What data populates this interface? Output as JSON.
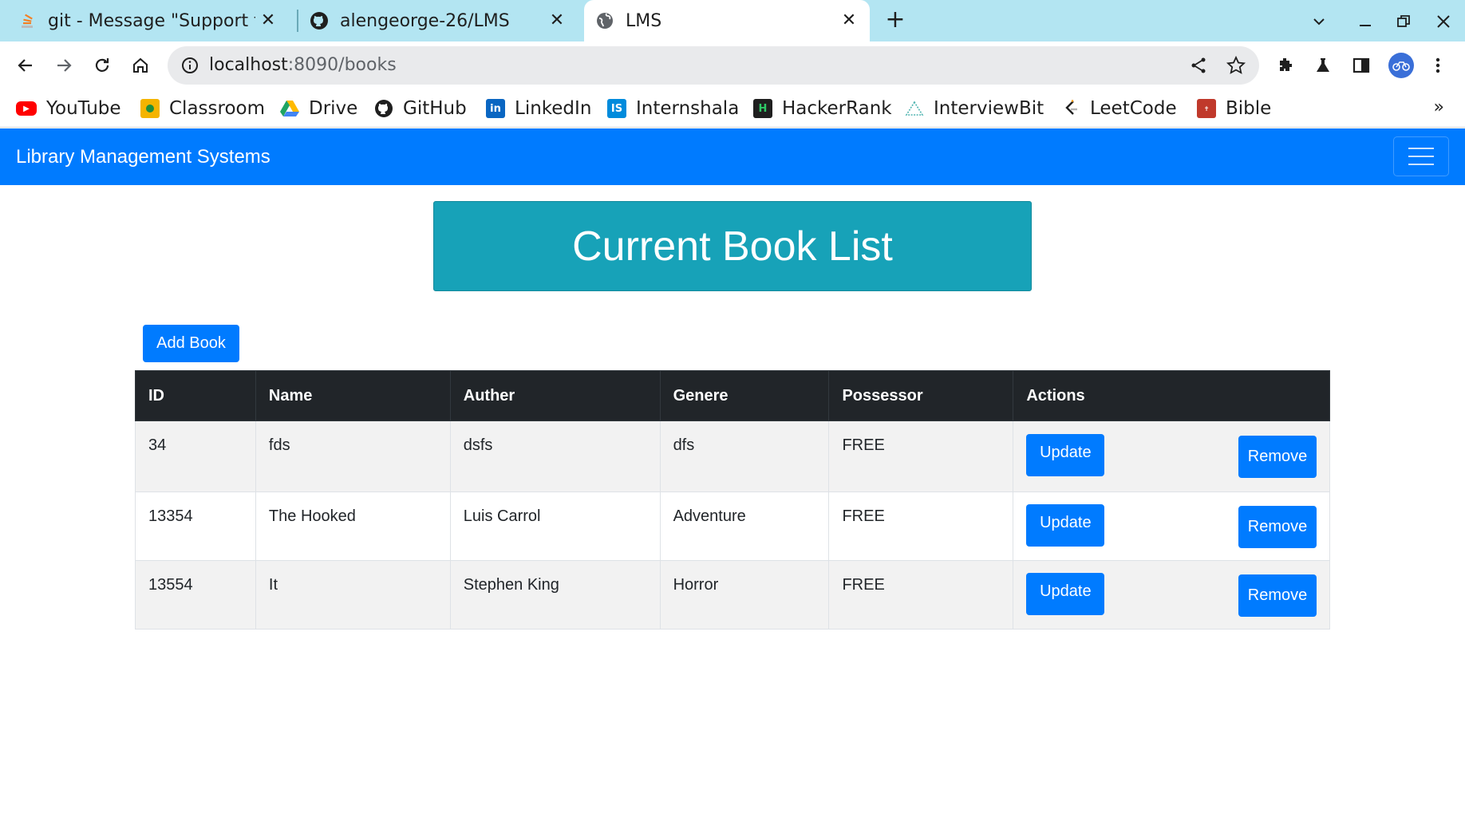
{
  "browser": {
    "tabs": [
      {
        "title": "git - Message \"Support f",
        "icon": "stackoverflow-icon",
        "active": false
      },
      {
        "title": "alengeorge-26/LMS",
        "icon": "github-icon",
        "active": false
      },
      {
        "title": "LMS",
        "icon": "globe-icon",
        "active": true
      }
    ],
    "address": {
      "host": "localhost",
      "path": ":8090/books"
    },
    "bookmarks": [
      {
        "label": "YouTube",
        "icon": "youtube-icon",
        "color": "#ff0000"
      },
      {
        "label": "Classroom",
        "icon": "classroom-icon",
        "color": "#f4b400"
      },
      {
        "label": "Drive",
        "icon": "drive-icon",
        "color": "#1fa463"
      },
      {
        "label": "GitHub",
        "icon": "github-icon",
        "color": "#1f1f1f"
      },
      {
        "label": "LinkedIn",
        "icon": "linkedin-icon",
        "color": "#0a66c2"
      },
      {
        "label": "Internshala",
        "icon": "internshala-icon",
        "color": "#008bdc"
      },
      {
        "label": "HackerRank",
        "icon": "hackerrank-icon",
        "color": "#1f1f1f"
      },
      {
        "label": "InterviewBit",
        "icon": "interviewbit-icon",
        "color": "#4fb4b0"
      },
      {
        "label": "LeetCode",
        "icon": "leetcode-icon",
        "color": "#f89f1b"
      },
      {
        "label": "Bible",
        "icon": "bible-icon",
        "color": "#c0392b"
      }
    ],
    "more_bookmarks": "»"
  },
  "app": {
    "brand": "Library Management Systems",
    "heading": "Current Book List",
    "add_button": "Add Book",
    "columns": [
      "ID",
      "Name",
      "Auther",
      "Genere",
      "Possessor",
      "Actions"
    ],
    "rows": [
      {
        "id": "34",
        "name": "fds",
        "author": "dsfs",
        "genre": "dfs",
        "possessor": "FREE"
      },
      {
        "id": "13354",
        "name": "The Hooked",
        "author": "Luis Carrol",
        "genre": "Adventure",
        "possessor": "FREE"
      },
      {
        "id": "13554",
        "name": "It",
        "author": "Stephen King",
        "genre": "Horror",
        "possessor": "FREE"
      }
    ],
    "update_label": "Update",
    "remove_label": "Remove",
    "colors": {
      "navbar": "#007bff",
      "banner": "#17a2b8",
      "table_head": "#212529",
      "button": "#007bff"
    }
  }
}
